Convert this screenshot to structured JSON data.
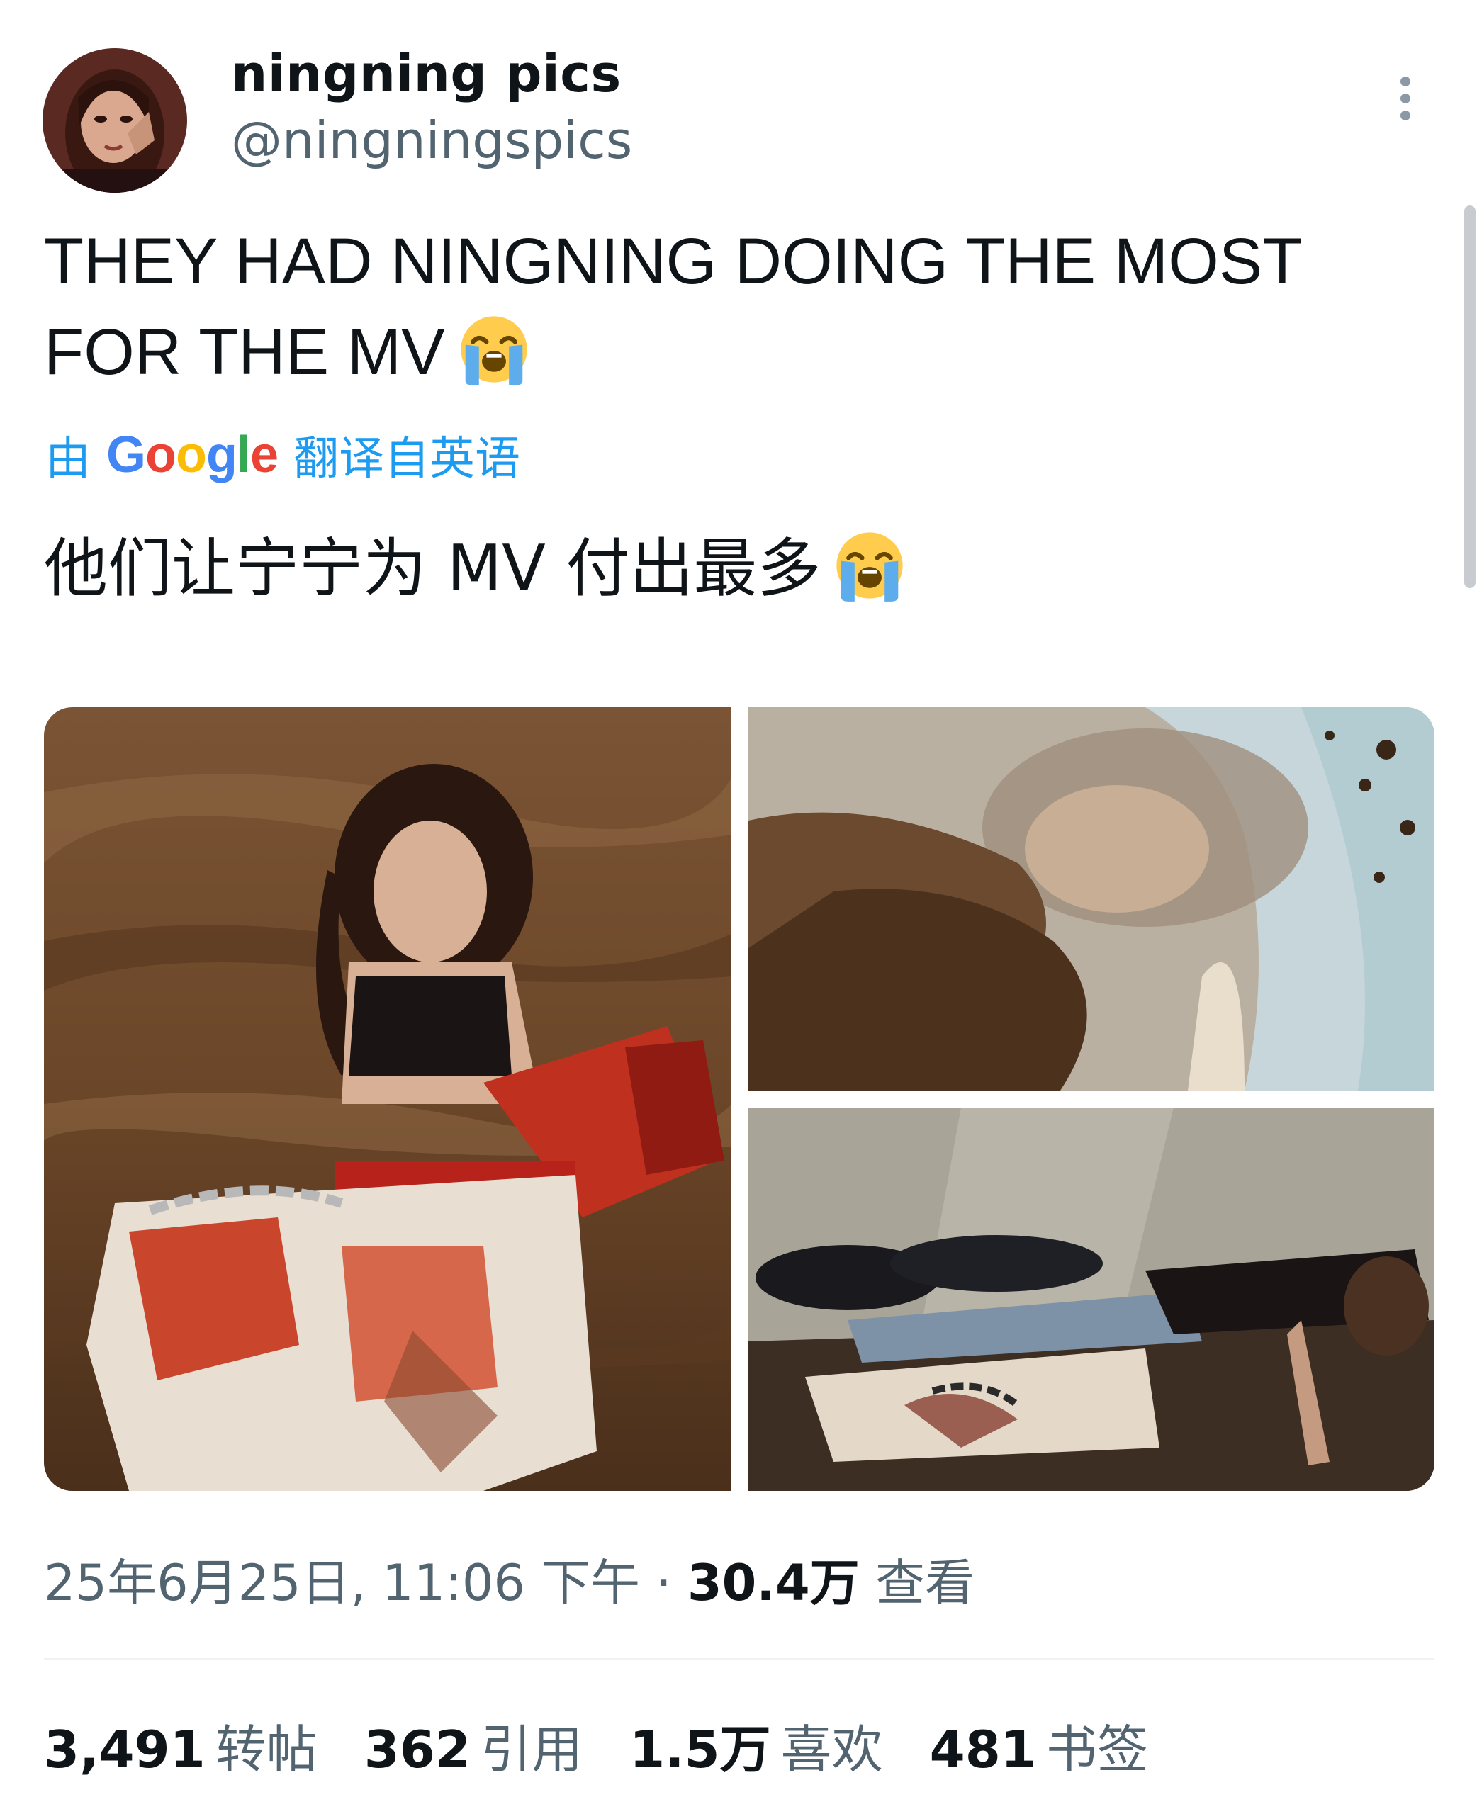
{
  "user": {
    "display_name": "ningning pics",
    "handle": "@ningningspics"
  },
  "tweet": {
    "text_line1": "THEY HAD NINGNING DOING THE MOST",
    "text_line2": "FOR THE MV",
    "emoji": "loudly-crying-face"
  },
  "translation": {
    "prefix": "由",
    "provider": "Google",
    "suffix": "翻译自英语",
    "text": "他们让宁宁为 MV 付出最多"
  },
  "media": {
    "photos": [
      {
        "description_icon": "photo-mud-kneeling"
      },
      {
        "description_icon": "photo-closeup-dirt"
      },
      {
        "description_icon": "photo-lying-ground"
      }
    ]
  },
  "meta": {
    "timestamp": "25年6月25日, 11:06 下午",
    "separator": "·",
    "views_count": "30.4万",
    "views_label": "查看"
  },
  "stats": {
    "retweets_count": "3,491",
    "retweets_label": "转帖",
    "quotes_count": "362",
    "quotes_label": "引用",
    "likes_count": "1.5万",
    "likes_label": "喜欢",
    "bookmarks_count": "481",
    "bookmarks_label": "书签"
  },
  "colors": {
    "link_blue": "#1d9bf0",
    "secondary_gray": "#536471",
    "text_black": "#0f1419"
  }
}
